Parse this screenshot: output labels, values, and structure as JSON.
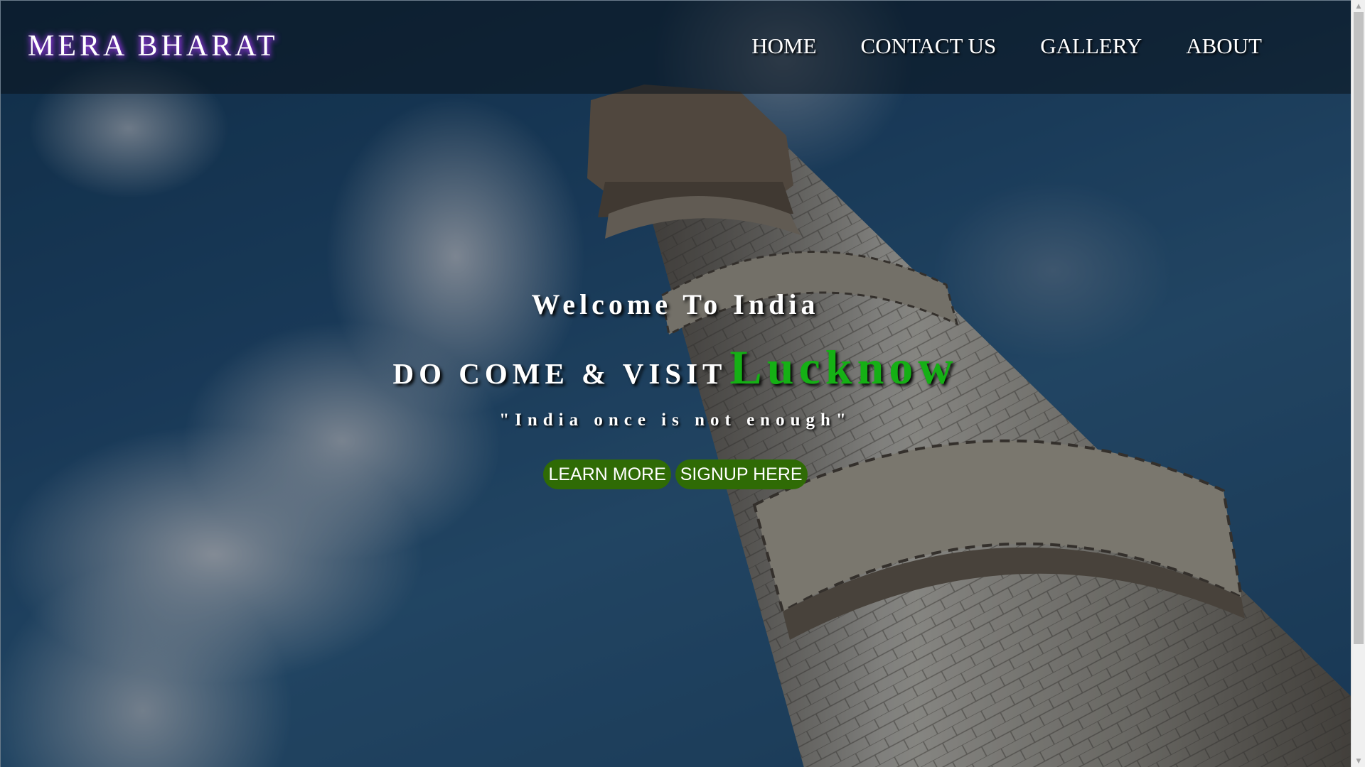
{
  "header": {
    "brand": "MERA BHARAT",
    "nav": [
      {
        "label": "HOME"
      },
      {
        "label": "CONTACT US"
      },
      {
        "label": "GALLERY"
      },
      {
        "label": "ABOUT"
      }
    ]
  },
  "hero": {
    "welcome": "Welcome To India",
    "visit_prefix": "DO COME & VISIT",
    "city": "Lucknow",
    "tagline": "\"India once is not enough\"",
    "buttons": {
      "learn_more": "LEARN MORE",
      "signup": "SIGNUP HERE"
    },
    "background": "minaret-and-clouds-photo"
  },
  "colors": {
    "accent_green": "#15b015",
    "button_green": "#2f6b05",
    "brand_glow": "#b04dff"
  },
  "icons": {
    "scroll_up": "scroll-up-arrow-icon",
    "scroll_down": "scroll-down-arrow-icon"
  }
}
